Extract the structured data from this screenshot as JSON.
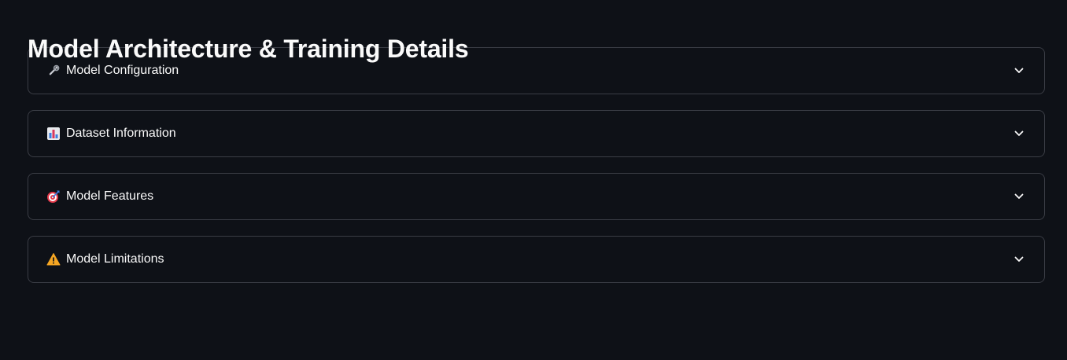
{
  "page": {
    "title": "Model Architecture & Training Details",
    "background": "#0e1117"
  },
  "expanders": [
    {
      "icon": "wrench-icon",
      "label": "Model Configuration",
      "expanded": false
    },
    {
      "icon": "bar-chart-icon",
      "label": "Dataset Information",
      "expanded": false
    },
    {
      "icon": "target-icon",
      "label": "Model Features",
      "expanded": false
    },
    {
      "icon": "warning-icon",
      "label": "Model Limitations",
      "expanded": false
    }
  ],
  "colors": {
    "text": "#fafafa",
    "border": "#3a3d45",
    "warning": "#f5a623",
    "target": "#e5394a"
  }
}
